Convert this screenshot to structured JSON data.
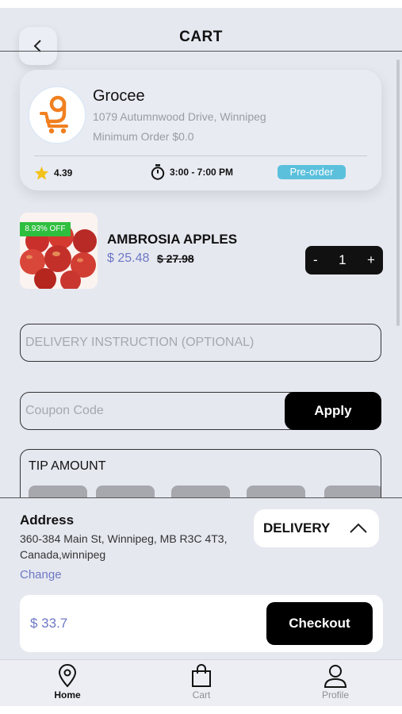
{
  "header": {
    "title": "CART"
  },
  "store": {
    "name": "Grocee",
    "address": "1079 Autumnwood Drive, Winnipeg",
    "minimum_order": "Minimum Order $0.0",
    "rating": "4.39",
    "hours": "3:00 - 7:00 PM",
    "badge": "Pre-order",
    "logo_color": "#f07f1f"
  },
  "product": {
    "name": "AMBROSIA APPLES",
    "price": "$ 25.48",
    "old_price": "$ 27.98",
    "discount": "8.93% OFF",
    "quantity": "1",
    "minus": "-",
    "plus": "+"
  },
  "delivery_instruction": {
    "placeholder": "DELIVERY INSTRUCTION (OPTIONAL)",
    "value": ""
  },
  "coupon": {
    "placeholder": "Coupon Code",
    "value": "",
    "apply_label": "Apply"
  },
  "tip": {
    "title": "TIP AMOUNT"
  },
  "address": {
    "label": "Address",
    "text": "360-384 Main St, Winnipeg, MB R3C 4T3, Canada,winnipeg",
    "change_label": "Change"
  },
  "delivery_mode": {
    "label": "DELIVERY"
  },
  "checkout": {
    "total": "$ 33.7",
    "button_label": "Checkout"
  },
  "tabbar": {
    "items": [
      {
        "label": "Home",
        "icon": "location-pin-icon",
        "active": true
      },
      {
        "label": "Cart",
        "icon": "shopping-bag-icon",
        "active": false
      },
      {
        "label": "Profile",
        "icon": "user-icon",
        "active": false
      }
    ]
  },
  "colors": {
    "accent": "#6d78c4",
    "preorder": "#5bc0dc",
    "discount": "#2fbf3f",
    "background": "#e6e8f0"
  }
}
